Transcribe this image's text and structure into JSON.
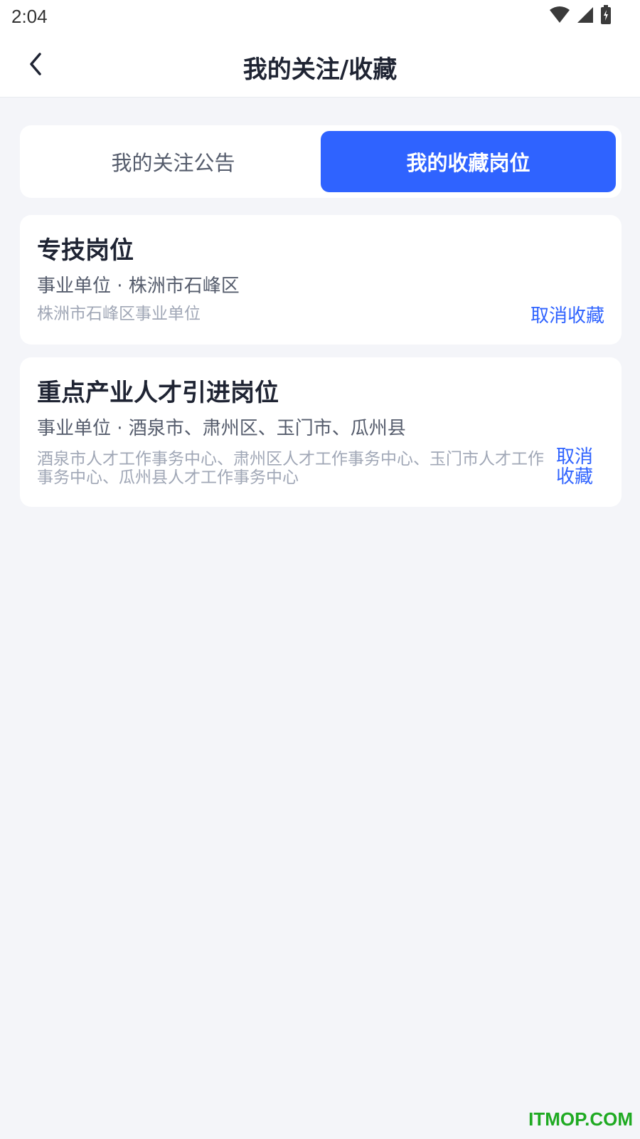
{
  "status_bar": {
    "time": "2:04",
    "icons": [
      "wifi-icon",
      "cell-signal-icon",
      "battery-charging-icon"
    ]
  },
  "header": {
    "back_icon": "chevron-left-icon",
    "title": "我的关注/收藏"
  },
  "tabs": [
    {
      "label": "我的关注公告",
      "active": false
    },
    {
      "label": "我的收藏岗位",
      "active": true
    }
  ],
  "favorites": [
    {
      "title": "专技岗位",
      "meta": "事业单位 · 株洲市石峰区",
      "org": "株洲市石峰区事业单位",
      "action": "取消收藏"
    },
    {
      "title": "重点产业人才引进岗位",
      "meta": "事业单位 · 酒泉市、肃州区、玉门市、瓜州县",
      "org": "酒泉市人才工作事务中心、肃州区人才工作事务中心、玉门市人才工作事务中心、瓜州县人才工作事务中心",
      "action": "取消收藏"
    }
  ],
  "watermark": "ITMOP.COM",
  "colors": {
    "accent": "#2f63ff",
    "background": "#f4f5f9",
    "title_text": "#1f2433",
    "secondary_text": "#a0a7b6",
    "watermark": "#1faa22"
  }
}
